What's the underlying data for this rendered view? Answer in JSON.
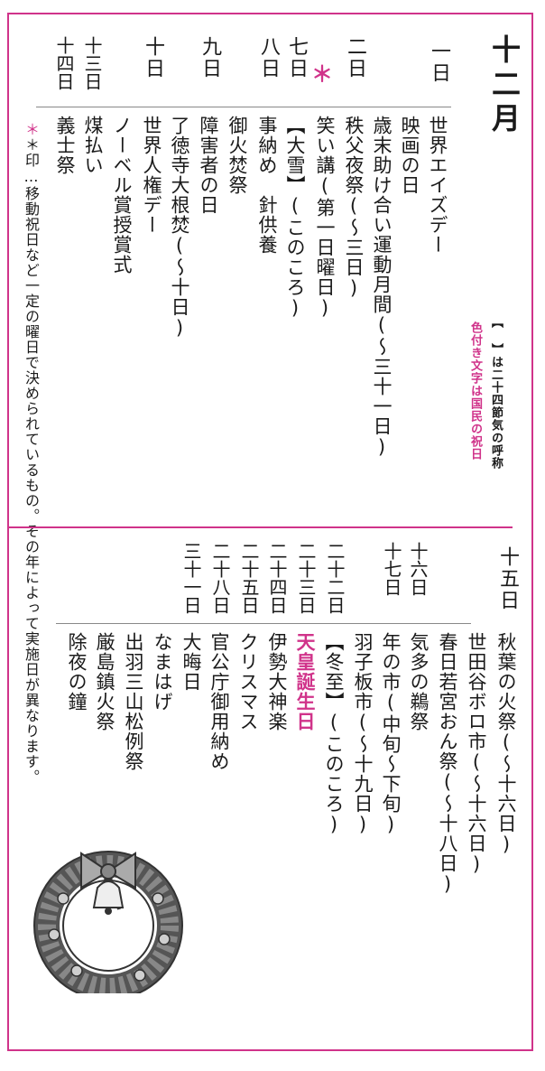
{
  "month": "十二月",
  "legend": {
    "bracket_note": "【 】は二十四節気の呼称",
    "color_note": "色付き文字は国民の祝日"
  },
  "star_mark": "＊",
  "upper": [
    {
      "date": "一日",
      "events": [
        "世界エイズデー",
        "映画の日"
      ]
    },
    {
      "date": "二日",
      "events": [
        "歳末助け合い運動月間(〜三十一日)",
        "秩父夜祭(〜三日)"
      ]
    },
    {
      "date": "七日",
      "events": [
        "笑い講(第一日曜日)",
        "【大雪】(このころ)"
      ]
    },
    {
      "date": "八日",
      "events": [
        "事納め　針供養"
      ]
    },
    {
      "date": "九日",
      "events": [
        "御火焚祭",
        "障害者の日",
        "了徳寺大根焚(〜十日)"
      ]
    },
    {
      "date": "十日",
      "events": [
        "世界人権デー",
        "ノーベル賞授賞式"
      ]
    },
    {
      "date": "十三日",
      "events": [
        "煤払い"
      ]
    },
    {
      "date": "十四日",
      "events": [
        "義士祭"
      ]
    }
  ],
  "lower": [
    {
      "date": "十五日",
      "events": [
        "秋葉の火祭(〜十六日)",
        "世田谷ボロ市(〜十六日)"
      ]
    },
    {
      "date": "十六日",
      "events": []
    },
    {
      "date": "十七日",
      "events": [
        "春日若宮おん祭(〜十八日)",
        "気多の鵜祭",
        "年の市(中旬〜下旬)",
        "羽子板市(〜十九日)"
      ]
    },
    {
      "date": "二十二日",
      "events": [
        "【冬至】(このころ)"
      ]
    },
    {
      "date": "二十三日",
      "events": [
        "天皇誕生日"
      ]
    },
    {
      "date": "二十四日",
      "events": [
        "伊勢大神楽",
        "クリスマス"
      ]
    },
    {
      "date": "二十五日",
      "events": []
    },
    {
      "date": "二十八日",
      "events": [
        "官公庁御用納め"
      ]
    },
    {
      "date": "三十一日",
      "events": [
        "大晦日",
        "なまはげ",
        "出羽三山松例祭",
        "厳島鎮火祭",
        "除夜の鐘"
      ]
    }
  ],
  "footnote": "＊印…移動祝日など一定の曜日で決められているもの。その年によって実施日が異なります。",
  "colors": {
    "accent": "#d0338a",
    "text": "#1a1a1a"
  },
  "illustration": "christmas-wreath-icon"
}
